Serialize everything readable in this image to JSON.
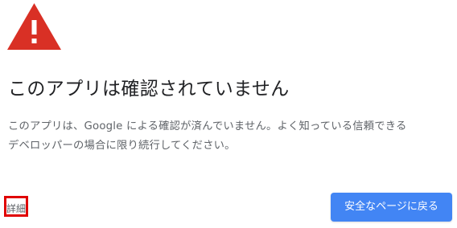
{
  "colors": {
    "warning_red": "#d93025",
    "primary_blue": "#4285f4",
    "highlight_border": "#e00000",
    "title_text": "#202124",
    "body_text": "#5f6368"
  },
  "icons": {
    "warning": "warning-triangle-icon"
  },
  "title": "このアプリは確認されていません",
  "message": {
    "line1": "このアプリは、Google による確認が済んでいません。よく知っている信頼できる",
    "line2": "デベロッパーの場合に限り続行してください。"
  },
  "details_link": "詳細",
  "primary_button": "安全なページに戻る"
}
